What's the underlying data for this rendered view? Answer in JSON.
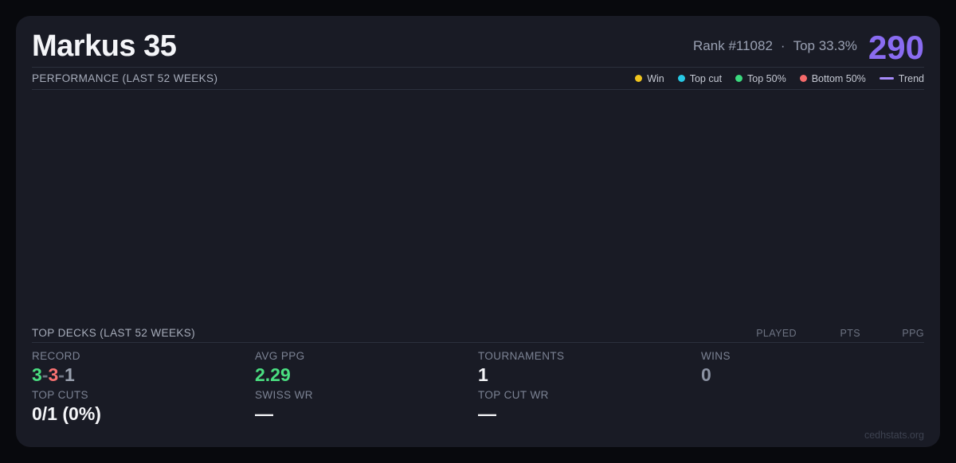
{
  "player": {
    "name": "Markus 35",
    "rank": "Rank #11082",
    "separator": "·",
    "top_percent": "Top 33.3%",
    "score": "290"
  },
  "performance": {
    "title": "PERFORMANCE (LAST 52 WEEKS)",
    "legend": [
      {
        "label": "Win"
      },
      {
        "label": "Top cut"
      },
      {
        "label": "Top 50%"
      },
      {
        "label": "Bottom 50%"
      },
      {
        "label": "Trend"
      }
    ]
  },
  "top_decks": {
    "title": "TOP DECKS (LAST 52 WEEKS)",
    "columns": [
      "PLAYED",
      "PTS",
      "PPG"
    ]
  },
  "stats": {
    "record": {
      "label": "RECORD",
      "wins": "3",
      "losses": "3",
      "draws": "1",
      "sep": "-"
    },
    "avg_ppg": {
      "label": "AVG PPG",
      "value": "2.29"
    },
    "tournaments": {
      "label": "TOURNAMENTS",
      "value": "1"
    },
    "wins": {
      "label": "WINS",
      "value": "0"
    },
    "top_cuts": {
      "label": "TOP CUTS",
      "value": "0/1 (0%)"
    },
    "swiss_wr": {
      "label": "SWISS WR",
      "value": "—"
    },
    "top_cut_wr": {
      "label": "TOP CUT WR",
      "value": "—"
    }
  },
  "footer": {
    "watermark": "cedhstats.org"
  },
  "colors": {
    "accent": "#8a6cf1",
    "green": "#4ade80",
    "red": "#f87171",
    "win": "#f0c51d",
    "topcut": "#27c8e4",
    "top50": "#3bd97e",
    "bottom50": "#f56a6a",
    "trend": "#a78bfa"
  }
}
